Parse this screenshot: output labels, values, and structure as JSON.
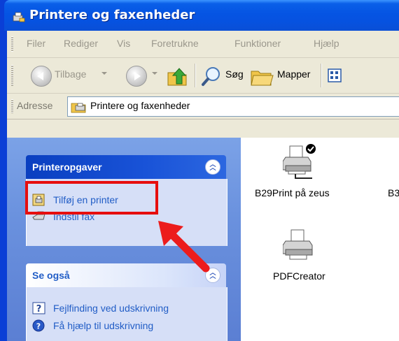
{
  "window": {
    "title": "Printere og faxenheder"
  },
  "menubar": {
    "items": [
      "Filer",
      "Rediger",
      "Vis",
      "Foretrukne",
      "Funktioner",
      "Hjælp"
    ]
  },
  "toolbar": {
    "back_label": "Tilbage",
    "search_label": "Søg",
    "folders_label": "Mapper"
  },
  "addressbar": {
    "label": "Adresse",
    "value": "Printere og faxenheder"
  },
  "taskpane": {
    "printer_tasks": {
      "title": "Printeropgaver",
      "items": [
        {
          "label": "Tilføj en printer",
          "icon": "add-printer-icon"
        },
        {
          "label": "Indstil fax",
          "icon": "fax-icon"
        }
      ]
    },
    "see_also": {
      "title": "Se også",
      "items": [
        {
          "label": "Fejlfinding ved udskrivning",
          "icon": "help-question-icon"
        },
        {
          "label": "Få hjælp til udskrivning",
          "icon": "help-circle-icon"
        }
      ]
    }
  },
  "files": [
    {
      "label": "B29Print på zeus",
      "icon": "network-printer-default-icon"
    },
    {
      "label": "B3",
      "icon": "printer-icon"
    },
    {
      "label": "PDFCreator",
      "icon": "printer-icon"
    }
  ],
  "colors": {
    "title_bar": "#0554e3",
    "task_pane": "#6a91de",
    "link": "#215dc6",
    "highlight": "#e60e0e"
  }
}
